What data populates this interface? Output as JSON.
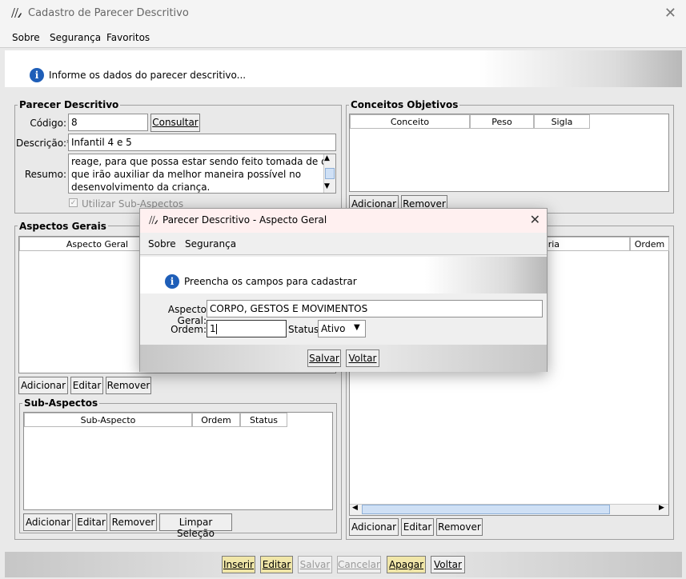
{
  "window": {
    "title": "Cadastro de Parecer Descritivo"
  },
  "menu": {
    "sobre": "Sobre",
    "seguranca": "Segurança",
    "favoritos": "Favoritos"
  },
  "banner": {
    "text": "Informe os dados do parecer descritivo..."
  },
  "parecer": {
    "legend": "Parecer Descritivo",
    "codigo_label": "Código:",
    "codigo_value": "8",
    "consultar": "Consultar",
    "descricao_label": "Descrição:*",
    "descricao_value": "Infantil 4 e 5",
    "resumo_label": "Resumo:",
    "resumo_lines": [
      "reage, para que possa estar sendo feito tomada de decisões",
      "que irão  auxiliar da melhor maneira possível no",
      "desenvolvimento da criança."
    ],
    "utilizar_sub": "Utilizar Sub-Aspectos"
  },
  "conceitos": {
    "legend": "Conceitos Objetivos",
    "columns": [
      "Conceito",
      "Peso",
      "Sigla"
    ],
    "adicionar": "Adicionar",
    "remover": "Remover"
  },
  "aspectos": {
    "legend": "Aspectos Gerais",
    "columns": [
      "Aspecto Geral"
    ],
    "adicionar": "Adicionar",
    "editar": "Editar",
    "remover": "Remover"
  },
  "right_table": {
    "columns": [
      "oria",
      "Ordem"
    ],
    "adicionar": "Adicionar",
    "editar": "Editar",
    "remover": "Remover"
  },
  "sub_aspectos": {
    "legend": "Sub-Aspectos",
    "columns": [
      "Sub-Aspecto",
      "Ordem",
      "Status"
    ],
    "adicionar": "Adicionar",
    "editar": "Editar",
    "remover": "Remover",
    "limpar": "Limpar Seleção"
  },
  "footer": {
    "inserir": "Inserir",
    "editar": "Editar",
    "salvar": "Salvar",
    "cancelar": "Cancelar",
    "apagar": "Apagar",
    "voltar": "Voltar"
  },
  "dialog": {
    "title": "Parecer Descritivo - Aspecto Geral",
    "menu_sobre": "Sobre",
    "menu_seguranca": "Segurança",
    "banner": "Preencha os campos para cadastrar",
    "aspecto_label": "Aspecto Geral:",
    "aspecto_value": "CORPO, GESTOS E MOVIMENTOS",
    "ordem_label": "Ordem:",
    "ordem_value": "1",
    "status_label": "Status:",
    "status_value": "Ativo",
    "salvar": "Salvar",
    "voltar": "Voltar"
  },
  "colors": {
    "accent_yellow": "#f0e6a8",
    "info_blue": "#1e5eb8"
  },
  "icons": [
    "app-logo-icon",
    "close-icon",
    "info-icon",
    "chevron-down-icon",
    "scroll-up-icon",
    "scroll-down-icon",
    "scroll-left-icon",
    "scroll-right-icon",
    "checkbox-icon"
  ]
}
